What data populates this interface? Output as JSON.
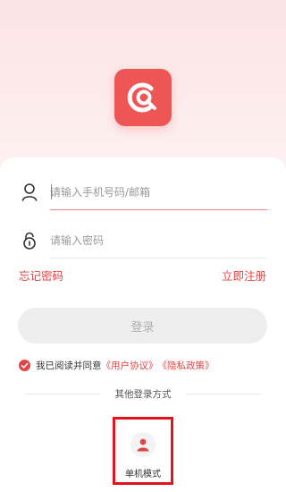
{
  "app": {
    "brand_color": "#ee5555",
    "logo_icon": "app-logo-icon"
  },
  "form": {
    "account": {
      "placeholder": "请输入手机号码/邮箱",
      "value": "",
      "icon": "user-icon"
    },
    "password": {
      "placeholder": "请输入密码",
      "value": "",
      "icon": "lock-icon"
    },
    "forgot_label": "忘记密码",
    "register_label": "立即注册",
    "login_label": "登录"
  },
  "agreement": {
    "checked": true,
    "text": "我已阅读并同意",
    "user_agreement": "《用户协议》",
    "privacy_policy": "《隐私政策》"
  },
  "other_login": {
    "title": "其他登录方式",
    "single_mode_label": "单机模式",
    "single_mode_icon": "person-icon"
  }
}
